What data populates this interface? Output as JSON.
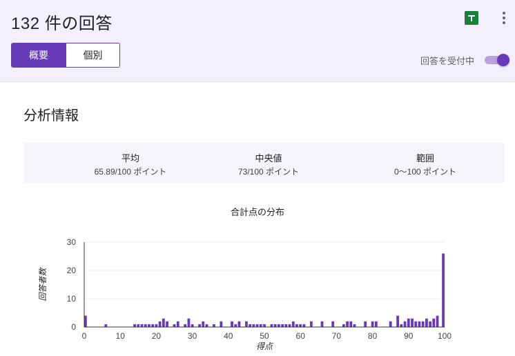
{
  "header": {
    "title": "132 件の回答",
    "tabs": [
      {
        "label": "概要",
        "active": true
      },
      {
        "label": "個別",
        "active": false
      }
    ],
    "accepting_label": "回答を受付中",
    "accepting_on": true,
    "icons": {
      "sheets": "google-sheets-icon",
      "more": "more-vert-icon"
    },
    "accent_color": "#673ab7"
  },
  "analysis": {
    "title": "分析情報",
    "stats": [
      {
        "label": "平均",
        "value": "65.89/100 ポイント"
      },
      {
        "label": "中央値",
        "value": "73/100 ポイント"
      },
      {
        "label": "範囲",
        "value": "0〜100 ポイント"
      }
    ]
  },
  "chart_data": {
    "type": "bar",
    "title": "合計点の分布",
    "xlabel": "得点",
    "ylabel": "回答者数",
    "xlim": [
      0,
      100
    ],
    "ylim": [
      0,
      30
    ],
    "xticks": [
      0,
      10,
      20,
      30,
      40,
      50,
      60,
      70,
      80,
      90,
      100
    ],
    "yticks": [
      0,
      10,
      20,
      30
    ],
    "grid": true,
    "bar_color": "#673ab7",
    "x": [
      0,
      6,
      14,
      15,
      16,
      17,
      18,
      19,
      20,
      21,
      22,
      23,
      25,
      26,
      28,
      29,
      30,
      32,
      33,
      34,
      36,
      38,
      41,
      42,
      43,
      45,
      46,
      47,
      48,
      49,
      50,
      52,
      53,
      54,
      55,
      56,
      57,
      58,
      59,
      60,
      61,
      63,
      66,
      69,
      72,
      73,
      74,
      75,
      78,
      80,
      81,
      85,
      87,
      88,
      89,
      90,
      91,
      92,
      93,
      94,
      95,
      96,
      97,
      98,
      100
    ],
    "values": [
      4,
      1,
      1,
      1,
      1,
      1,
      1,
      1,
      1,
      2,
      3,
      2,
      1,
      2,
      1,
      3,
      1,
      1,
      2,
      1,
      1,
      2,
      2,
      1,
      2,
      2,
      1,
      1,
      1,
      1,
      1,
      1,
      1,
      1,
      1,
      1,
      1,
      2,
      1,
      1,
      1,
      2,
      2,
      2,
      1,
      2,
      2,
      1,
      2,
      2,
      2,
      2,
      4,
      1,
      2,
      3,
      3,
      2,
      2,
      2,
      3,
      2,
      3,
      4,
      26
    ]
  }
}
